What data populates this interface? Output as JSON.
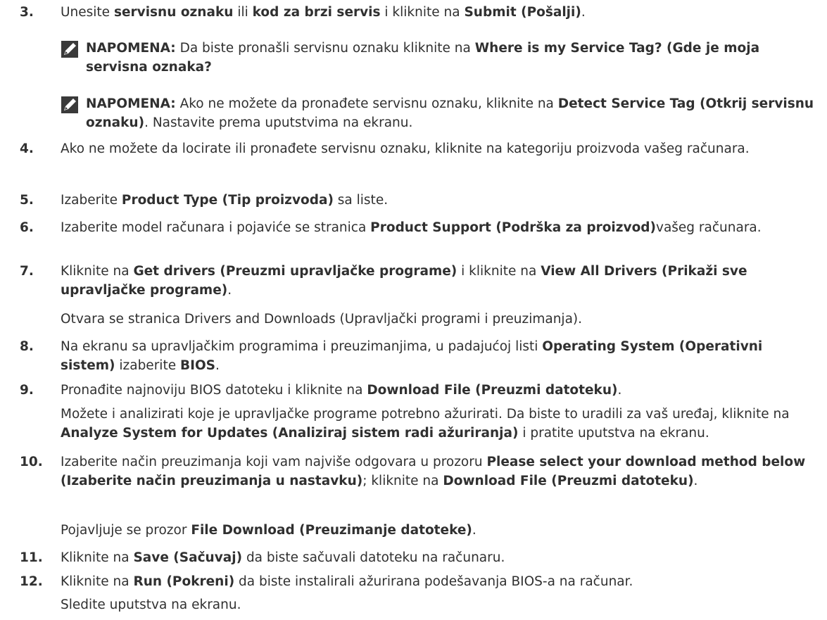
{
  "steps": [
    {
      "num": "3.",
      "segments": [
        {
          "t": "Unesite "
        },
        {
          "t": "servisnu oznaku",
          "b": true
        },
        {
          "t": " ili "
        },
        {
          "t": "kod za brzi servis",
          "b": true
        },
        {
          "t": " i kliknite na "
        },
        {
          "t": "Submit (Pošalji)",
          "b": true
        },
        {
          "t": "."
        }
      ]
    },
    {
      "num": "4.",
      "segments": [
        {
          "t": "Ako ne možete da locirate ili pronađete servisnu oznaku, kliknite na kategoriju proizvoda vašeg računara."
        }
      ]
    },
    {
      "num": "5.",
      "segments": [
        {
          "t": "Izaberite "
        },
        {
          "t": "Product Type (Tip proizvoda)",
          "b": true
        },
        {
          "t": " sa liste."
        }
      ]
    },
    {
      "num": "6.",
      "segments": [
        {
          "t": "Izaberite model računara i pojaviće se stranica "
        },
        {
          "t": "Product Support (Podrška za proizvod)",
          "b": true
        },
        {
          "t": "vašeg računara."
        }
      ]
    },
    {
      "num": "7.",
      "segments": [
        {
          "t": "Kliknite na "
        },
        {
          "t": "Get drivers (Preuzmi upravljačke programe)",
          "b": true
        },
        {
          "t": " i kliknite na "
        },
        {
          "t": "View All Drivers (Prikaži sve upravljačke programe)",
          "b": true
        },
        {
          "t": "."
        }
      ]
    },
    {
      "num": "8.",
      "segments": [
        {
          "t": "Na ekranu sa upravljačkim programima i preuzimanjima, u padajućoj listi "
        },
        {
          "t": "Operating System (Operativni sistem)",
          "b": true
        },
        {
          "t": " izaberite "
        },
        {
          "t": "BIOS",
          "b": true
        },
        {
          "t": "."
        }
      ]
    },
    {
      "num": "9.",
      "segments": [
        {
          "t": "Pronađite najnoviju BIOS datoteku i kliknite na "
        },
        {
          "t": "Download File (Preuzmi datoteku)",
          "b": true
        },
        {
          "t": "."
        }
      ]
    },
    {
      "num": "10.",
      "segments": [
        {
          "t": "Izaberite način preuzimanja koji vam najviše odgovara u prozoru "
        },
        {
          "t": "Please select your download method below (Izaberite način preuzimanja u nastavku)",
          "b": true
        },
        {
          "t": "; kliknite na "
        },
        {
          "t": "Download File (Preuzmi datoteku)",
          "b": true
        },
        {
          "t": "."
        }
      ]
    },
    {
      "num": "11.",
      "segments": [
        {
          "t": "Kliknite na "
        },
        {
          "t": "Save (Sačuvaj)",
          "b": true
        },
        {
          "t": " da biste sačuvali datoteku na računaru."
        }
      ]
    },
    {
      "num": "12.",
      "segments": [
        {
          "t": "Kliknite na "
        },
        {
          "t": "Run (Pokreni)",
          "b": true
        },
        {
          "t": " da biste instalirali ažurirana podešavanja BIOS-a na računar."
        }
      ]
    }
  ],
  "notes": [
    {
      "segments": [
        {
          "t": "NAPOMENA:",
          "b": true
        },
        {
          "t": " Da biste pronašli servisnu oznaku kliknite na "
        },
        {
          "t": "Where is my Service Tag? (Gde je moja servisna oznaka?",
          "b": true
        }
      ]
    },
    {
      "segments": [
        {
          "t": "NAPOMENA:",
          "b": true
        },
        {
          "t": " Ako ne možete da pronađete servisnu oznaku, kliknite na "
        },
        {
          "t": "Detect Service Tag (Otkrij servisnu oznaku)",
          "b": true
        },
        {
          "t": ". Nastavite prema uputstvima na ekranu."
        }
      ]
    }
  ],
  "paragraphs": [
    {
      "segments": [
        {
          "t": "Otvara se stranica Drivers and Downloads (Upravljački programi i preuzimanja)."
        }
      ]
    },
    {
      "segments": [
        {
          "t": "Možete i analizirati koje je upravljačke programe potrebno ažurirati. Da biste to uradili za vaš uređaj, kliknite na "
        },
        {
          "t": "Analyze System for Updates (Analiziraj sistem radi ažuriranja)",
          "b": true
        },
        {
          "t": " i pratite uputstva na ekranu."
        }
      ]
    },
    {
      "segments": [
        {
          "t": "Pojavljuje se prozor "
        },
        {
          "t": "File Download (Preuzimanje datoteke)",
          "b": true
        },
        {
          "t": "."
        }
      ]
    },
    {
      "segments": [
        {
          "t": "Sledite uputstva na ekranu."
        }
      ]
    }
  ],
  "icon_name": "note-pencil-icon"
}
